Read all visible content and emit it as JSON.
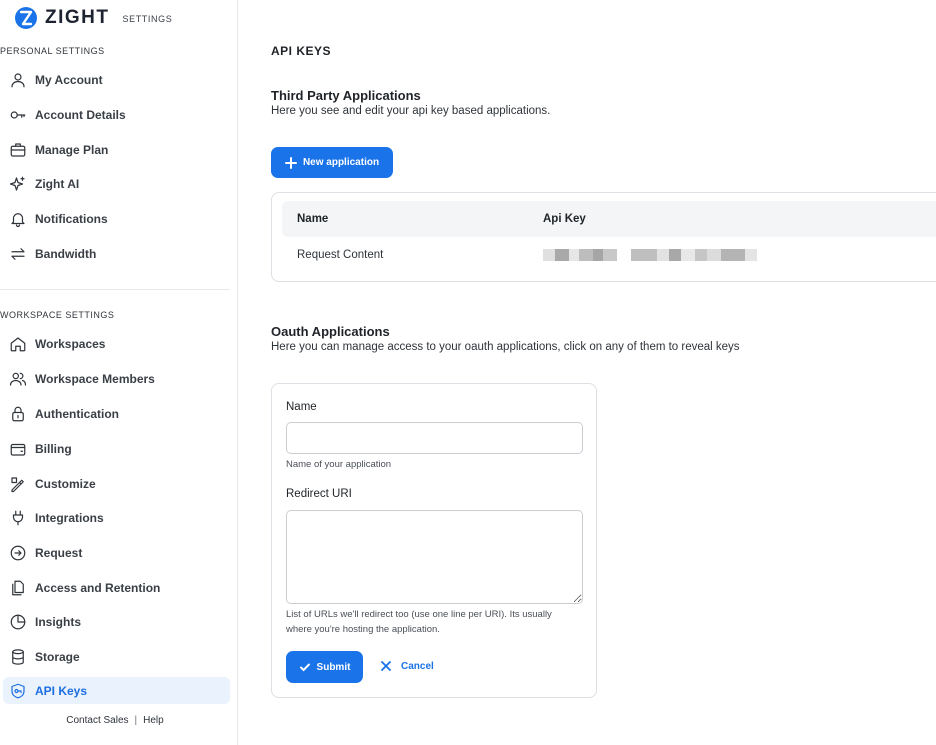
{
  "brand": {
    "name": "ZIGHT",
    "subtitle": "SETTINGS",
    "color": "#1a73e8"
  },
  "sidebar": {
    "personal_label": "PERSONAL SETTINGS",
    "personal_items": [
      {
        "label": "My Account",
        "icon": "user-icon"
      },
      {
        "label": "Account Details",
        "icon": "key-icon"
      },
      {
        "label": "Manage Plan",
        "icon": "briefcase-icon"
      },
      {
        "label": "Zight AI",
        "icon": "sparkles-icon"
      },
      {
        "label": "Notifications",
        "icon": "bell-icon"
      },
      {
        "label": "Bandwidth",
        "icon": "arrows-icon"
      }
    ],
    "workspace_label": "WORKSPACE SETTINGS",
    "workspace_items": [
      {
        "label": "Workspaces",
        "icon": "home-icon"
      },
      {
        "label": "Workspace Members",
        "icon": "users-icon"
      },
      {
        "label": "Authentication",
        "icon": "lock-icon"
      },
      {
        "label": "Billing",
        "icon": "wallet-icon"
      },
      {
        "label": "Customize",
        "icon": "customize-icon"
      },
      {
        "label": "Integrations",
        "icon": "plug-icon"
      },
      {
        "label": "Request",
        "icon": "request-icon"
      },
      {
        "label": "Access and Retention",
        "icon": "documents-icon"
      },
      {
        "label": "Insights",
        "icon": "pie-chart-icon"
      },
      {
        "label": "Storage",
        "icon": "database-icon"
      },
      {
        "label": "API Keys",
        "icon": "shield-key-icon",
        "active": true
      }
    ],
    "footer": {
      "contact": "Contact Sales",
      "separator": "|",
      "help": "Help"
    }
  },
  "main": {
    "title": "API KEYS",
    "third_party": {
      "heading": "Third Party Applications",
      "description": "Here you see and edit your api key based applications.",
      "new_button": "New application",
      "columns": [
        "Name",
        "Api Key"
      ],
      "rows": [
        {
          "name": "Request Content"
        }
      ]
    },
    "oauth": {
      "heading": "Oauth Applications",
      "description": "Here you can manage access to your oauth applications, click on any of them to reveal keys",
      "form": {
        "name_label": "Name",
        "name_value": "",
        "name_help": "Name of your application",
        "redirect_label": "Redirect URI",
        "redirect_value": "",
        "redirect_help": "List of URLs we'll redirect too (use one line per URI). Its usually where you're hosting the application.",
        "submit": "Submit",
        "cancel": "Cancel"
      }
    }
  },
  "colors": {
    "accent": "#1a73e8",
    "active_bg": "#eaf2fd"
  }
}
